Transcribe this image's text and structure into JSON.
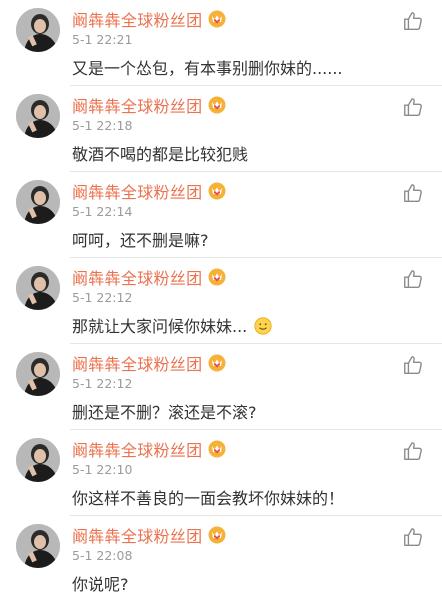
{
  "comments": [
    {
      "username": "阚犇犇全球粉丝团",
      "badge_icon": "vip-crown-badge-icon",
      "time": "5-1 22:21",
      "text": "又是一个怂包，有本事别删你妹的......"
    },
    {
      "username": "阚犇犇全球粉丝团",
      "badge_icon": "vip-crown-badge-icon",
      "time": "5-1 22:18",
      "text": "敬酒不喝的都是比较犯贱"
    },
    {
      "username": "阚犇犇全球粉丝团",
      "badge_icon": "vip-crown-badge-icon",
      "time": "5-1 22:14",
      "text": "呵呵，还不删是嘛?"
    },
    {
      "username": "阚犇犇全球粉丝团",
      "badge_icon": "vip-crown-badge-icon",
      "time": "5-1 22:12",
      "text": "那就让大家问候你妹妹...",
      "emoji": "smile-emoji-icon"
    },
    {
      "username": "阚犇犇全球粉丝团",
      "badge_icon": "vip-crown-badge-icon",
      "time": "5-1 22:12",
      "text": "删还是不删？滚还是不滚?"
    },
    {
      "username": "阚犇犇全球粉丝团",
      "badge_icon": "vip-crown-badge-icon",
      "time": "5-1 22:10",
      "text": "你这样不善良的一面会教坏你妹妹的！"
    },
    {
      "username": "阚犇犇全球粉丝团",
      "badge_icon": "vip-crown-badge-icon",
      "time": "5-1 22:08",
      "text": "你说呢?"
    }
  ],
  "like_icon": "thumbs-up-icon",
  "colors": {
    "username": "#eb7350",
    "timestamp": "#9b9b9b",
    "text": "#333333",
    "like_icon": "#8a8a8a"
  }
}
